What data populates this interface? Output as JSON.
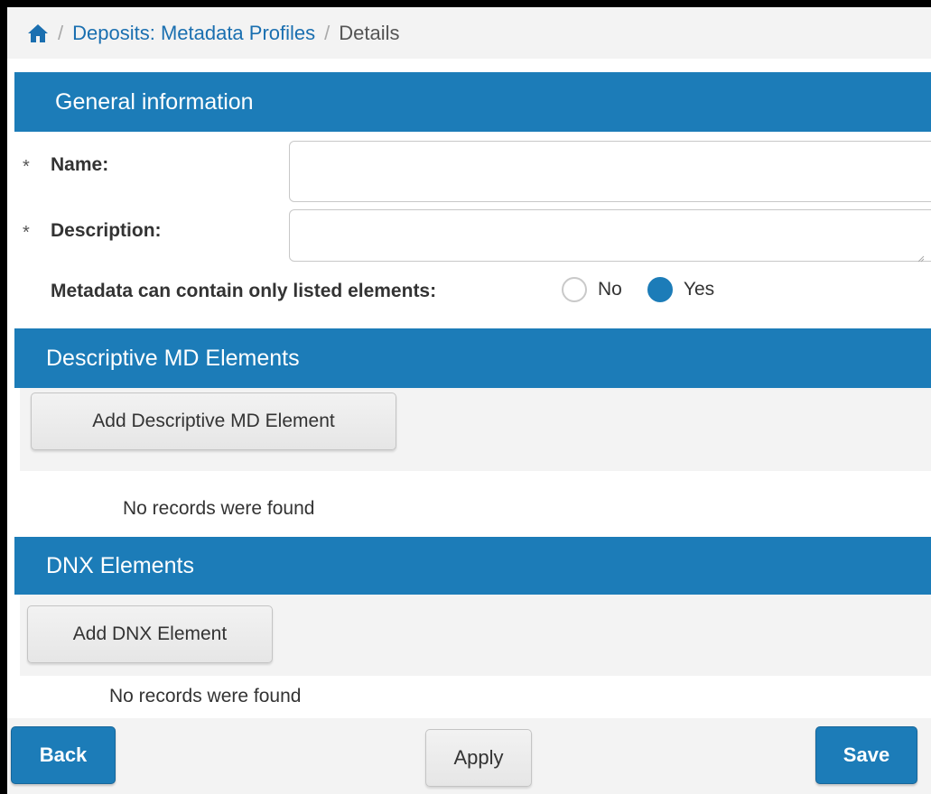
{
  "breadcrumb": {
    "home_icon": "home-icon",
    "separator": "/",
    "link": "Deposits: Metadata Profiles",
    "current": "Details"
  },
  "general": {
    "header": "General information",
    "name_label": "Name:",
    "name_value": "",
    "description_label": "Description:",
    "description_value": "",
    "required_marker": "*",
    "listed_label": "Metadata can contain only listed elements:",
    "options": [
      "No",
      "Yes"
    ],
    "selected": "Yes"
  },
  "descriptive": {
    "header": "Descriptive MD Elements",
    "add_button": "Add Descriptive MD Element",
    "empty_text": "No records were found"
  },
  "dnx": {
    "header": "DNX Elements",
    "add_button": "Add DNX Element",
    "empty_text": "No records were found"
  },
  "footer": {
    "back": "Back",
    "apply": "Apply",
    "save": "Save"
  },
  "colors": {
    "accent": "#1c7cb8",
    "link": "#1a6fb0",
    "panel": "#f3f3f3"
  }
}
